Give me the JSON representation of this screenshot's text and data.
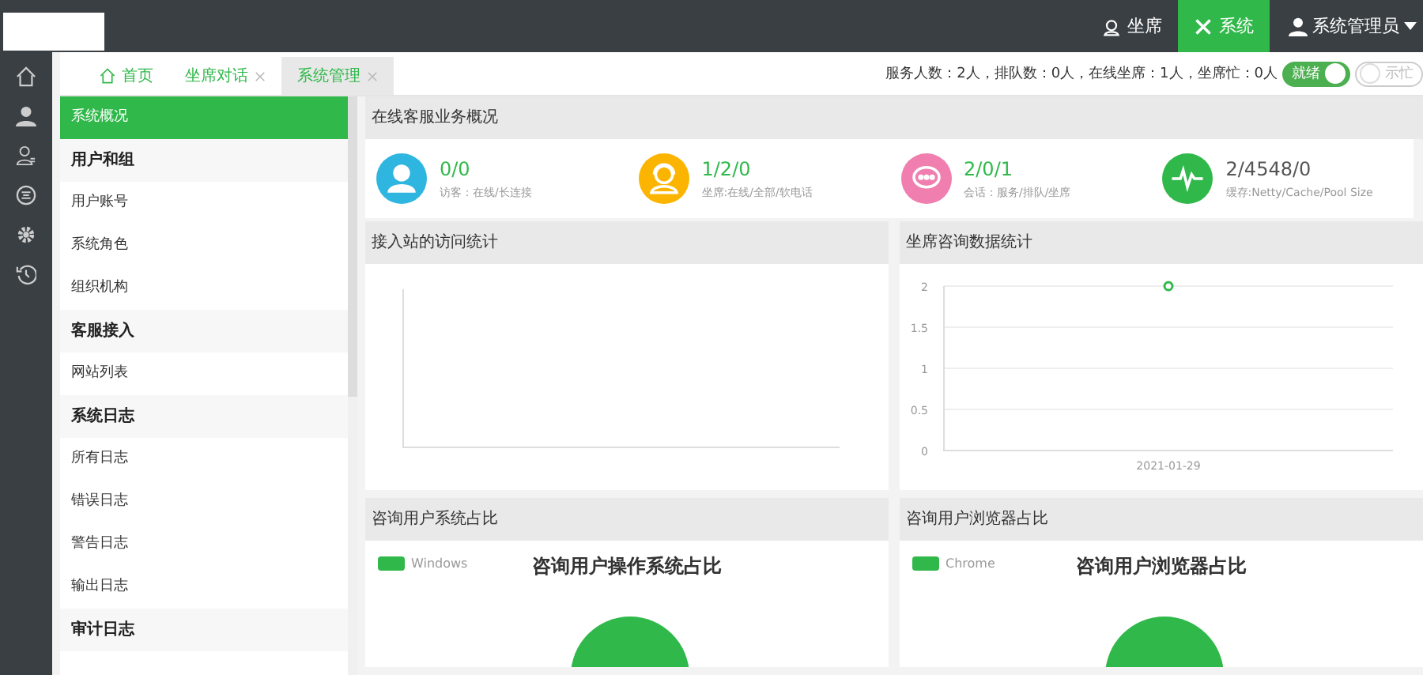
{
  "topbar": {
    "nav": [
      {
        "label": "坐席",
        "kind": "agent",
        "selected": false
      },
      {
        "label": "系统",
        "kind": "system",
        "selected": true
      }
    ],
    "user": "系统管理员"
  },
  "tabs": [
    {
      "label": "首页",
      "kind": "home",
      "selected": false
    },
    {
      "label": "坐席对话",
      "kind": "closable",
      "selected": false
    },
    {
      "label": "系统管理",
      "kind": "closable",
      "selected": true
    }
  ],
  "status": {
    "text": "服务人数：2人，排队数：0人，在线坐席：1人，坐席忙：0人",
    "toggles": [
      {
        "label": "就绪",
        "on": true
      },
      {
        "label": "示忙",
        "on": false
      }
    ]
  },
  "menu": [
    {
      "label": "系统概况",
      "kind": "link",
      "selected": true
    },
    {
      "label": "用户和组",
      "kind": "group"
    },
    {
      "label": "用户账号",
      "kind": "link",
      "selected": false
    },
    {
      "label": "系统角色",
      "kind": "link",
      "selected": false
    },
    {
      "label": "组织机构",
      "kind": "link",
      "selected": false
    },
    {
      "label": "客服接入",
      "kind": "group"
    },
    {
      "label": "网站列表",
      "kind": "link",
      "selected": false
    },
    {
      "label": "系统日志",
      "kind": "group"
    },
    {
      "label": "所有日志",
      "kind": "link",
      "selected": false
    },
    {
      "label": "错误日志",
      "kind": "link",
      "selected": false
    },
    {
      "label": "警告日志",
      "kind": "link",
      "selected": false
    },
    {
      "label": "输出日志",
      "kind": "link",
      "selected": false
    },
    {
      "label": "审计日志",
      "kind": "group"
    }
  ],
  "overview": {
    "title": "在线客服业务概况",
    "stats": [
      {
        "value": "0/0",
        "label": "访客：在线/长连接",
        "kind": "user",
        "color": "#2fb6e0"
      },
      {
        "value": "1/2/0",
        "label": "坐席:在线/全部/软电话",
        "kind": "agent",
        "color": "#fbb500"
      },
      {
        "value": "2/0/1",
        "label": "会话：服务/排队/坐席",
        "kind": "chat",
        "color": "#f07fb0"
      },
      {
        "value": "2/4548/0",
        "label": "缓存:Netty/Cache/Pool Size",
        "kind": "pulse",
        "color": "#30b94a"
      }
    ]
  },
  "visits": {
    "title": "接入站的访问统计"
  },
  "agent_stats": {
    "title": "坐席咨询数据统计",
    "chart_data": {
      "type": "scatter",
      "x": [
        "2021-01-29"
      ],
      "series": [
        {
          "color": "#30b94a",
          "values": [
            2
          ]
        }
      ],
      "ylim": [
        0,
        2
      ],
      "grid": true,
      "yticks": [
        0,
        0.5,
        1,
        1.5,
        2
      ]
    }
  },
  "os_share": {
    "title": "咨询用户系统占比",
    "legend": "Windows",
    "chart_title": "咨询用户操作系统占比"
  },
  "browser_share": {
    "title": "咨询用户浏览器占比",
    "legend": "Chrome",
    "chart_title": "咨询用户浏览器占比"
  }
}
